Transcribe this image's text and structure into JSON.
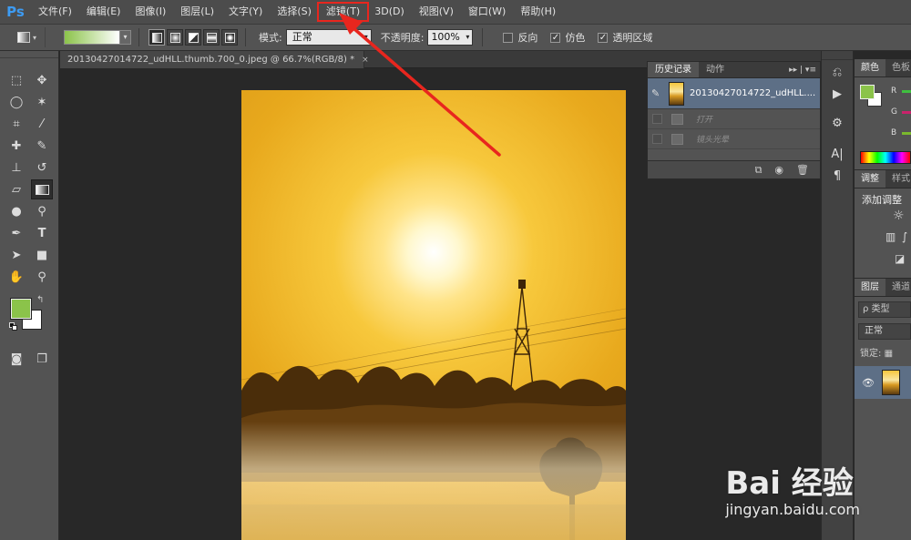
{
  "app": {
    "logo": "Ps"
  },
  "menu": [
    {
      "label": "文件(F)"
    },
    {
      "label": "编辑(E)"
    },
    {
      "label": "图像(I)"
    },
    {
      "label": "图层(L)"
    },
    {
      "label": "文字(Y)"
    },
    {
      "label": "选择(S)"
    },
    {
      "label": "滤镜(T)",
      "highlighted": true
    },
    {
      "label": "3D(D)"
    },
    {
      "label": "视图(V)"
    },
    {
      "label": "窗口(W)"
    },
    {
      "label": "帮助(H)"
    }
  ],
  "options": {
    "gradient_colors": [
      "#8bc34a",
      "#ffffff"
    ],
    "mode_label": "模式:",
    "mode_value": "正常",
    "opacity_label": "不透明度:",
    "opacity_value": "100%",
    "reverse_label": "反向",
    "reverse_checked": false,
    "dither_label": "仿色",
    "dither_checked": true,
    "transparency_label": "透明区域",
    "transparency_checked": true
  },
  "tools": {
    "foreground_color": "#8bc34a",
    "background_color": "#ffffff"
  },
  "document": {
    "tab_title": "20130427014722_udHLL.thumb.700_0.jpeg @ 66.7%(RGB/8) *",
    "close_glyph": "×"
  },
  "history_panel": {
    "tabs": [
      "历史记录",
      "动作"
    ],
    "snapshot_name": "20130427014722_udHLL....",
    "states": [
      {
        "name": "打开"
      },
      {
        "name": "镜头光晕"
      }
    ]
  },
  "right_panels": {
    "color_tabs": [
      "颜色",
      "色板"
    ],
    "channels": [
      {
        "name": "R",
        "color": "#3fbf3f"
      },
      {
        "name": "G",
        "color": "#c9226b"
      },
      {
        "name": "B",
        "color": "#7ab82c"
      }
    ],
    "adjust_tabs": [
      "调整",
      "样式"
    ],
    "adjust_title": "添加调整",
    "layer_tabs": [
      "图层",
      "通道"
    ],
    "layer_filter": "ρ 类型",
    "blend_mode": "正常",
    "lock_label": "锁定:"
  },
  "watermark": {
    "logo": "Bai 经验",
    "url": "jingyan.baidu.com"
  },
  "accent_colors": {
    "highlight_red": "#e8261e",
    "ps_blue": "#3d9bf2",
    "selection_blue": "#5d6f86"
  }
}
